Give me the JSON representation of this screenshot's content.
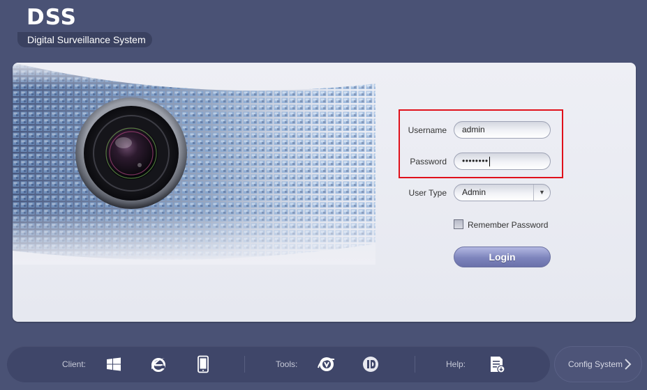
{
  "brand": {
    "title": "DSS",
    "subtitle": "Digital Surveillance System"
  },
  "login_form": {
    "username_label": "Username",
    "username_value": "admin",
    "password_label": "Password",
    "password_masked": "••••••••",
    "user_type_label": "User Type",
    "user_type_value": "Admin",
    "remember_label": "Remember Password",
    "remember_checked": false,
    "login_label": "Login"
  },
  "bottom_bar": {
    "client_label": "Client:",
    "tools_label": "Tools:",
    "help_label": "Help:",
    "client_icons": [
      "windows-icon",
      "ie-icon",
      "mobile-icon"
    ],
    "tool_icons": [
      "ie-plugin-icon",
      "player-icon"
    ],
    "help_icons": [
      "document-icon"
    ]
  },
  "config_button": {
    "label": "Config System"
  },
  "colors": {
    "background": "#4a5275",
    "panel": "#eeeff5",
    "highlight": "#e0101a",
    "login_button": "#7d84bc"
  }
}
